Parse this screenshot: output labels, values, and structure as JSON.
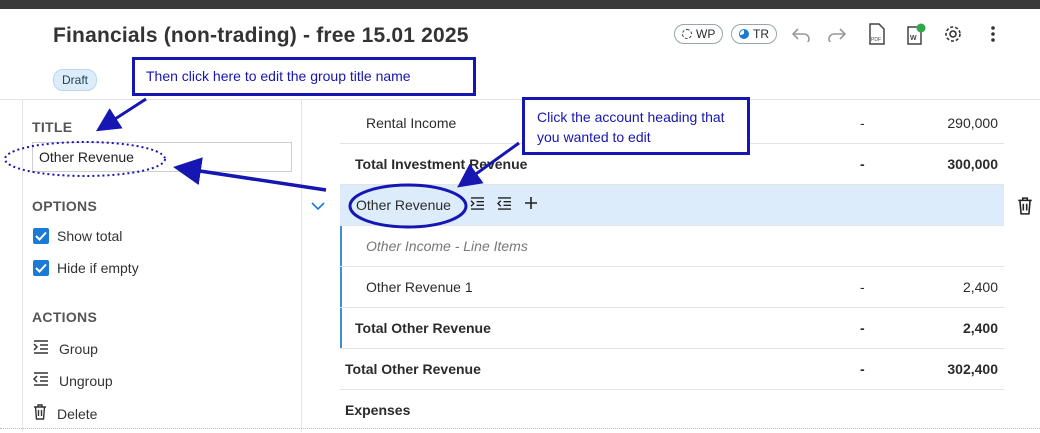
{
  "header": {
    "title": "Financials (non-trading)  -  free 15.01 2025",
    "status_badge": "Draft",
    "pills": [
      {
        "label": "WP"
      },
      {
        "label": "TR"
      }
    ],
    "icons": [
      "undo-icon",
      "redo-icon",
      "pdf-icon",
      "word-export-icon",
      "settings-icon",
      "more-vertical-icon"
    ]
  },
  "sidebar": {
    "title_heading": "TITLE",
    "title_value": "Other Revenue",
    "options_heading": "OPTIONS",
    "options": [
      {
        "label": "Show total",
        "checked": true
      },
      {
        "label": "Hide if empty",
        "checked": true
      }
    ],
    "actions_heading": "ACTIONS",
    "actions": [
      {
        "label": "Group",
        "icon": "indent-icon"
      },
      {
        "label": "Ungroup",
        "icon": "outdent-icon"
      },
      {
        "label": "Delete",
        "icon": "trash-icon"
      }
    ]
  },
  "main": {
    "rows": [
      {
        "label": "Rental Income",
        "dash": "-",
        "amount": "290,000"
      },
      {
        "label": "Total Investment Revenue",
        "dash": "-",
        "amount": "300,000"
      },
      {
        "label": "Other Revenue",
        "dash": "",
        "amount": ""
      },
      {
        "label": "Other Income - Line Items",
        "dash": "",
        "amount": ""
      },
      {
        "label": "Other Revenue 1",
        "dash": "-",
        "amount": "2,400"
      },
      {
        "label": "Total Other Revenue",
        "dash": "-",
        "amount": "2,400"
      },
      {
        "label": "Total Other Revenue",
        "dash": "-",
        "amount": "302,400"
      },
      {
        "label": "Expenses",
        "dash": "",
        "amount": ""
      }
    ]
  },
  "annotations": {
    "callout_group_title": "Then click here to edit the group title name",
    "callout_account_heading": "Click the account heading that you wanted to edit"
  },
  "colors": {
    "accent": "#1a7ad4",
    "annotation": "#1616b2",
    "selected_row": "#dcecfb"
  }
}
